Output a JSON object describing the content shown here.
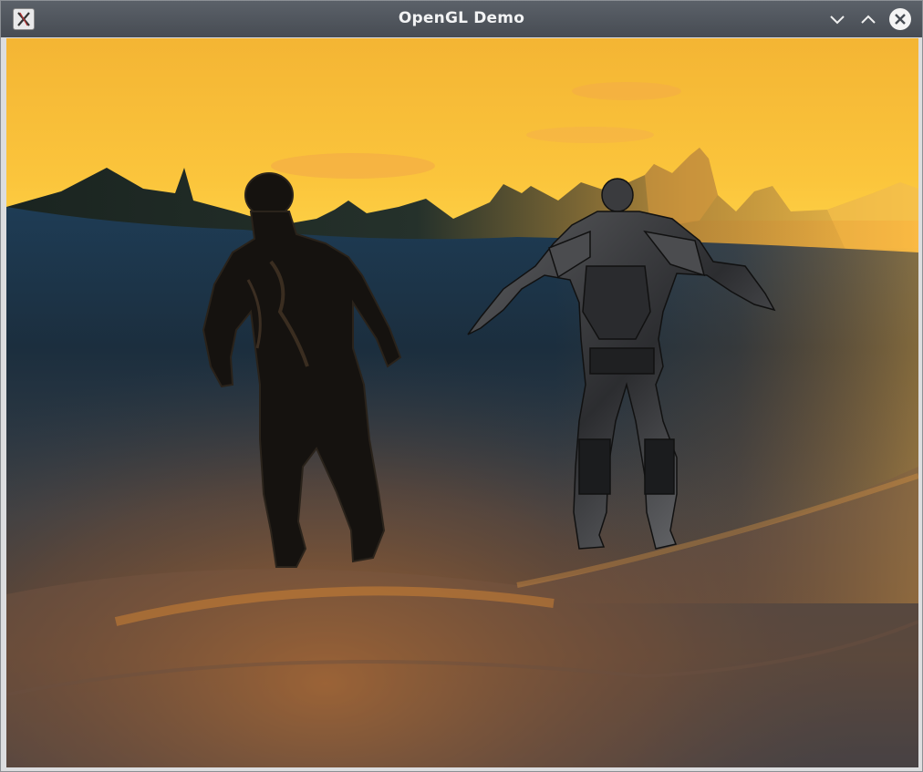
{
  "window": {
    "title": "OpenGL Demo",
    "icons": {
      "app": "x11-app-icon",
      "minimize": "chevron-down-icon",
      "maximize": "chevron-up-icon",
      "close": "close-icon"
    }
  },
  "scene": {
    "description_objects": [
      "sky",
      "mountain-range",
      "terrain",
      "character-left",
      "character-right"
    ],
    "colors": {
      "sky_top": "#f5b736",
      "sky_horizon": "#ffd84a",
      "terrain_dark": "#1d3347",
      "terrain_highlight": "#d9822c"
    }
  }
}
